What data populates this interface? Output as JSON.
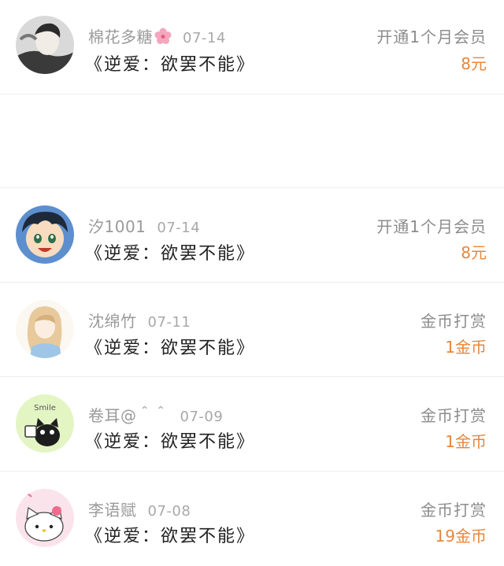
{
  "records": [
    {
      "user": "棉花多糖",
      "date": "07-14",
      "book": "《逆爱：欲罢不能》",
      "action": "开通1个月会员",
      "amount": "8元",
      "avatar_icon": "portrait-man-icon"
    },
    {
      "user": "汐1001",
      "date": "07-14",
      "book": "《逆爱：欲罢不能》",
      "action": "开通1个月会员",
      "amount": "8元",
      "avatar_icon": "anime-boy-icon"
    },
    {
      "user": "沈绵竹",
      "date": "07-11",
      "book": "《逆爱：欲罢不能》",
      "action": "金币打赏",
      "amount": "1金币",
      "avatar_icon": "sketch-girl-icon"
    },
    {
      "user": "卷耳@＾＾",
      "date": "07-09",
      "book": "《逆爱：欲罢不能》",
      "action": "金币打赏",
      "amount": "1金币",
      "avatar_icon": "cartoon-cat-icon"
    },
    {
      "user": "李语赋",
      "date": "07-08",
      "book": "《逆爱：欲罢不能》",
      "action": "金币打赏",
      "amount": "19金币",
      "avatar_icon": "hello-kitty-icon"
    }
  ],
  "colors": {
    "amount": "#e8863a",
    "meta": "#9a9a9a",
    "title": "#222222",
    "divider": "#ededed"
  }
}
